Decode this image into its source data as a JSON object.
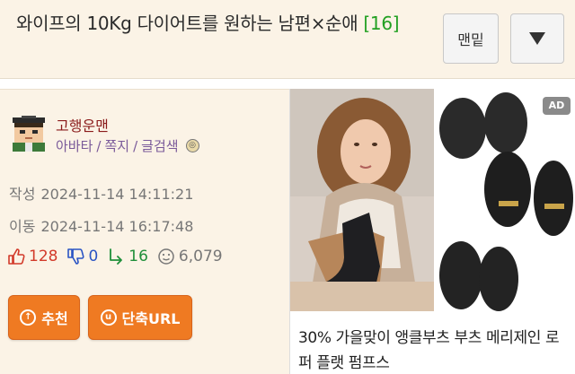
{
  "header": {
    "title_main": "와이프의 10Kg 다이어트를 원하는 남편×순애",
    "comment_count": "[16]",
    "top_button_label": "맨밑",
    "menu_button_icon": "triangle-down-icon"
  },
  "author": {
    "nickname": "고행운맨",
    "links": [
      "아바타",
      "쪽지",
      "글검색"
    ],
    "level_icon": "level-badge-icon"
  },
  "meta": {
    "created_label": "작성",
    "created": "2024-11-14 14:11:21",
    "moved_label": "이동",
    "moved": "2024-11-14 16:17:48"
  },
  "stats": {
    "up": "128",
    "down": "0",
    "replies": "16",
    "views": "6,079"
  },
  "actions": {
    "recommend_label": "추천",
    "short_url_label": "단축URL"
  },
  "ad": {
    "badge": "AD",
    "text": "30% 가을맞이 앵클부츠 부츠 메리제인 로퍼 플랫 펌프스"
  },
  "colors": {
    "header_bg": "#fbf3e6",
    "count_green": "#22a022",
    "action_orange": "#ef7a22"
  }
}
